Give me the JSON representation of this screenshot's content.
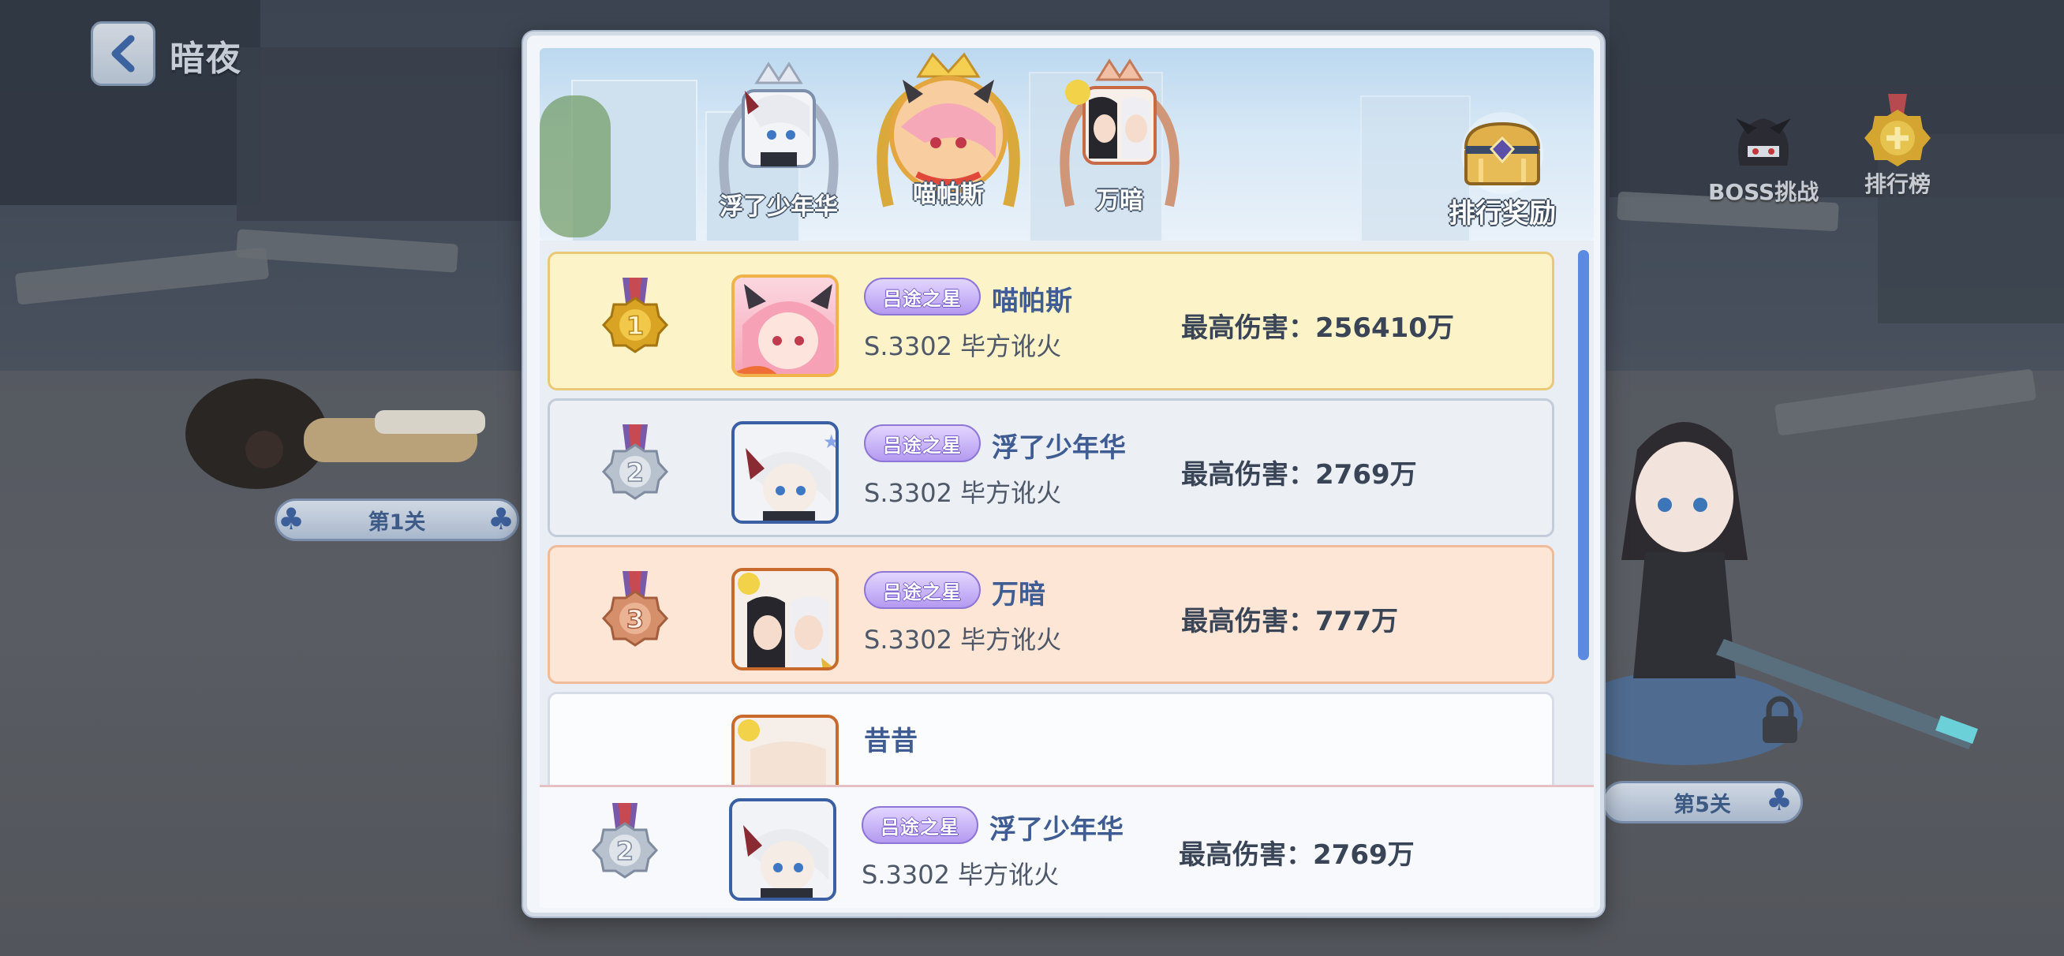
{
  "header": {
    "back_title": "暗夜"
  },
  "side_buttons": {
    "boss": "BOSS挑战",
    "ranking": "排行榜"
  },
  "stages": {
    "left": "第1关",
    "right": "第5关"
  },
  "podium": {
    "first": "喵帕斯",
    "second": "浮了少年华",
    "third": "万暗",
    "reward_label": "排行奖励"
  },
  "title_badge": "吕途之星",
  "rows": [
    {
      "rank": "1",
      "name": "喵帕斯",
      "server": "S.3302 毕方讹火",
      "damage": "最高伤害：256410万"
    },
    {
      "rank": "2",
      "name": "浮了少年华",
      "server": "S.3302 毕方讹火",
      "damage": "最高伤害：2769万"
    },
    {
      "rank": "3",
      "name": "万暗",
      "server": "S.3302 毕方讹火",
      "damage": "最高伤害：777万"
    },
    {
      "rank": "",
      "name": "昔昔",
      "server": "",
      "damage": ""
    }
  ],
  "self": {
    "rank": "2",
    "name": "浮了少年华",
    "server": "S.3302 毕方讹火",
    "damage": "最高伤害：2769万"
  },
  "colors": {
    "gold": "#fdf3c9",
    "silver": "#eceff4",
    "bronze": "#fde6d6",
    "accent": "#5b8ae0"
  }
}
